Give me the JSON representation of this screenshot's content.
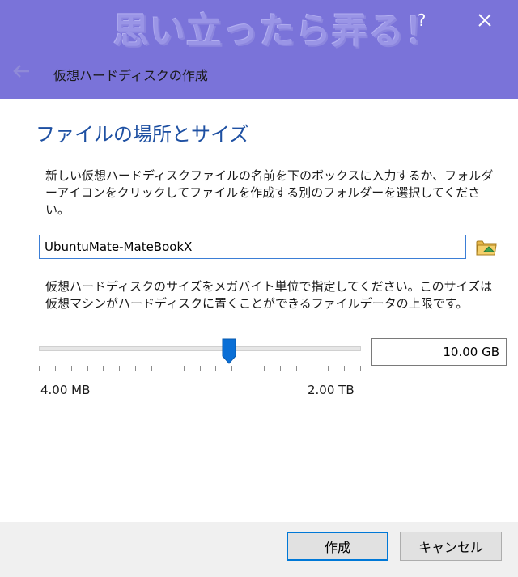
{
  "window": {
    "watermark_text": "思い立ったら弄る！",
    "help_label": "?",
    "title": "仮想ハードディスクの作成",
    "icons": {
      "back": "back-arrow-icon",
      "close": "close-icon",
      "folder": "folder-icon"
    }
  },
  "page": {
    "heading": "ファイルの場所とサイズ",
    "location_description": "新しい仮想ハードディスクファイルの名前を下のボックスに入力するか、フォルダーアイコンをクリックしてファイルを作成する別のフォルダーを選択してください。",
    "file_name_value": "UbuntuMate-MateBookX",
    "size_description": "仮想ハードディスクのサイズをメガバイト単位で指定してください。このサイズは仮想マシンがハードディスクに置くことができるファイルデータの上限です。",
    "size_slider": {
      "level_fraction": 0.59,
      "min_label": "4.00 MB",
      "max_label": "2.00 TB",
      "tick_count": 20
    },
    "size_value": "10.00 GB"
  },
  "buttons": {
    "create": "作成",
    "cancel": "キャンセル"
  },
  "colors": {
    "titlebar": "#7a73d9",
    "heading": "#1e50a2",
    "accent": "#0078d7",
    "slider_handle": "#0a6fd6"
  }
}
